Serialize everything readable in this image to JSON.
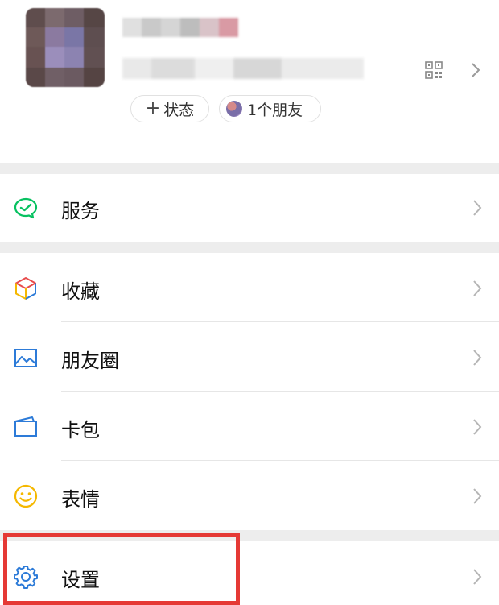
{
  "profile": {
    "status_chip": {
      "plus": "+",
      "label": "状态"
    },
    "friends_chip": {
      "label": "1个朋友"
    }
  },
  "menu": {
    "services": {
      "label": "服务",
      "icon": "services-icon"
    },
    "favorites": {
      "label": "收藏",
      "icon": "favorites-cube-icon"
    },
    "moments": {
      "label": "朋友圈",
      "icon": "moments-image-icon"
    },
    "cards": {
      "label": "卡包",
      "icon": "card-wallet-icon"
    },
    "stickers": {
      "label": "表情",
      "icon": "smiley-icon"
    },
    "settings": {
      "label": "设置",
      "icon": "gear-icon"
    }
  },
  "colors": {
    "separator": "#ededed",
    "highlight": "#e53935",
    "green": "#07c160",
    "blue": "#2d7bd8",
    "yellow": "#f5b800"
  }
}
